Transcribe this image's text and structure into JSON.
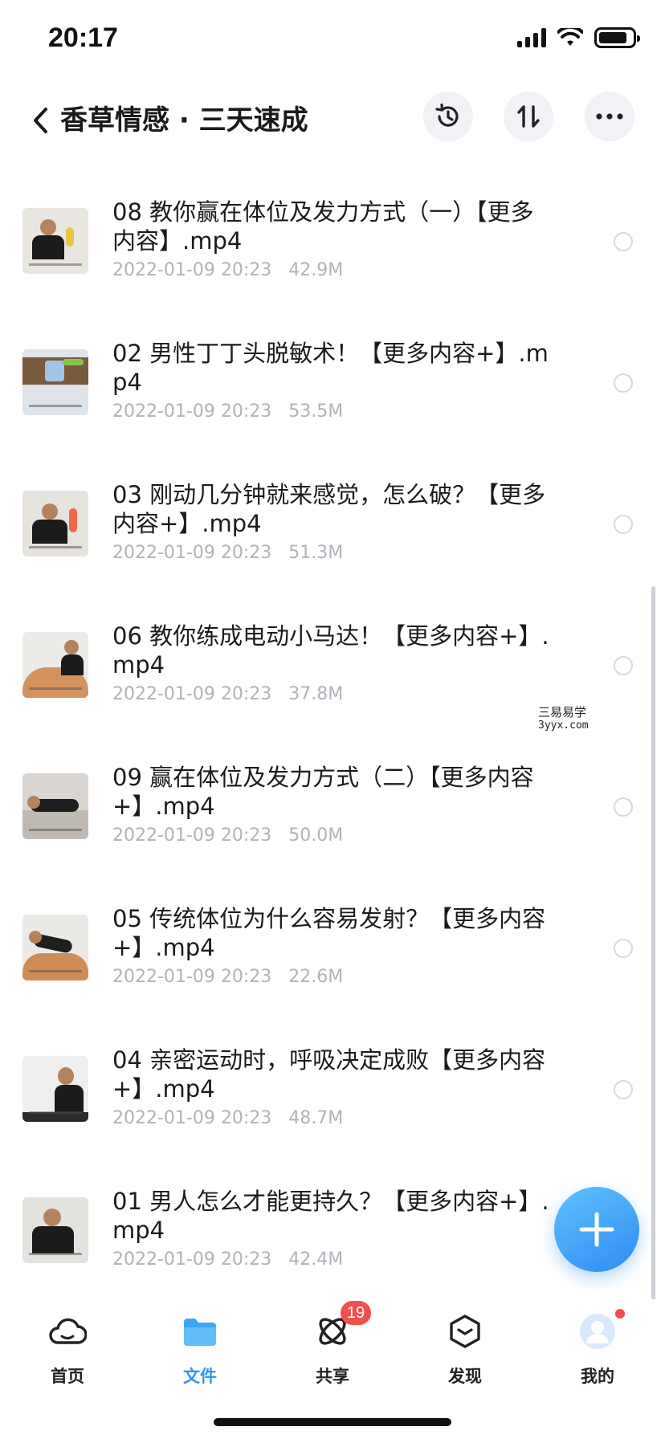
{
  "status_bar": {
    "time": "20:17"
  },
  "header": {
    "title": "香草情感 · 三天速成"
  },
  "files": [
    {
      "name": "08 教你赢在体位及发力方式（一）【更多内容】.mp4",
      "date": "2022-01-09 20:23",
      "size": "42.9M"
    },
    {
      "name": "02 男性丁丁头脱敏术！【更多内容+】.mp4",
      "date": "2022-01-09 20:23",
      "size": "53.5M"
    },
    {
      "name": "03 刚动几分钟就来感觉，怎么破？【更多内容+】.mp4",
      "date": "2022-01-09 20:23",
      "size": "51.3M"
    },
    {
      "name": "06 教你练成电动小马达！【更多内容+】.mp4",
      "date": "2022-01-09 20:23",
      "size": "37.8M"
    },
    {
      "name": "09 赢在体位及发力方式（二）【更多内容+】.mp4",
      "date": "2022-01-09 20:23",
      "size": "50.0M"
    },
    {
      "name": "05 传统体位为什么容易发射？【更多内容+】.mp4",
      "date": "2022-01-09 20:23",
      "size": "22.6M"
    },
    {
      "name": "04 亲密运动时，呼吸决定成败【更多内容+】.mp4",
      "date": "2022-01-09 20:23",
      "size": "48.7M"
    },
    {
      "name": "01 男人怎么才能更持久？【更多内容+】.mp4",
      "date": "2022-01-09 20:23",
      "size": "42.4M"
    }
  ],
  "watermark": {
    "cn": "三易易学",
    "en": "3yyx.com"
  },
  "bottom_nav": [
    {
      "label": "首页",
      "icon": "cloud-icon"
    },
    {
      "label": "文件",
      "icon": "folder-icon",
      "active": true
    },
    {
      "label": "共享",
      "icon": "share-icon",
      "badge": "19"
    },
    {
      "label": "发现",
      "icon": "discover-icon"
    },
    {
      "label": "我的",
      "icon": "avatar-icon"
    }
  ],
  "colors": {
    "accent": "#2f93f3",
    "badge": "#f04f4f",
    "meta_text": "#b0b3ba"
  }
}
